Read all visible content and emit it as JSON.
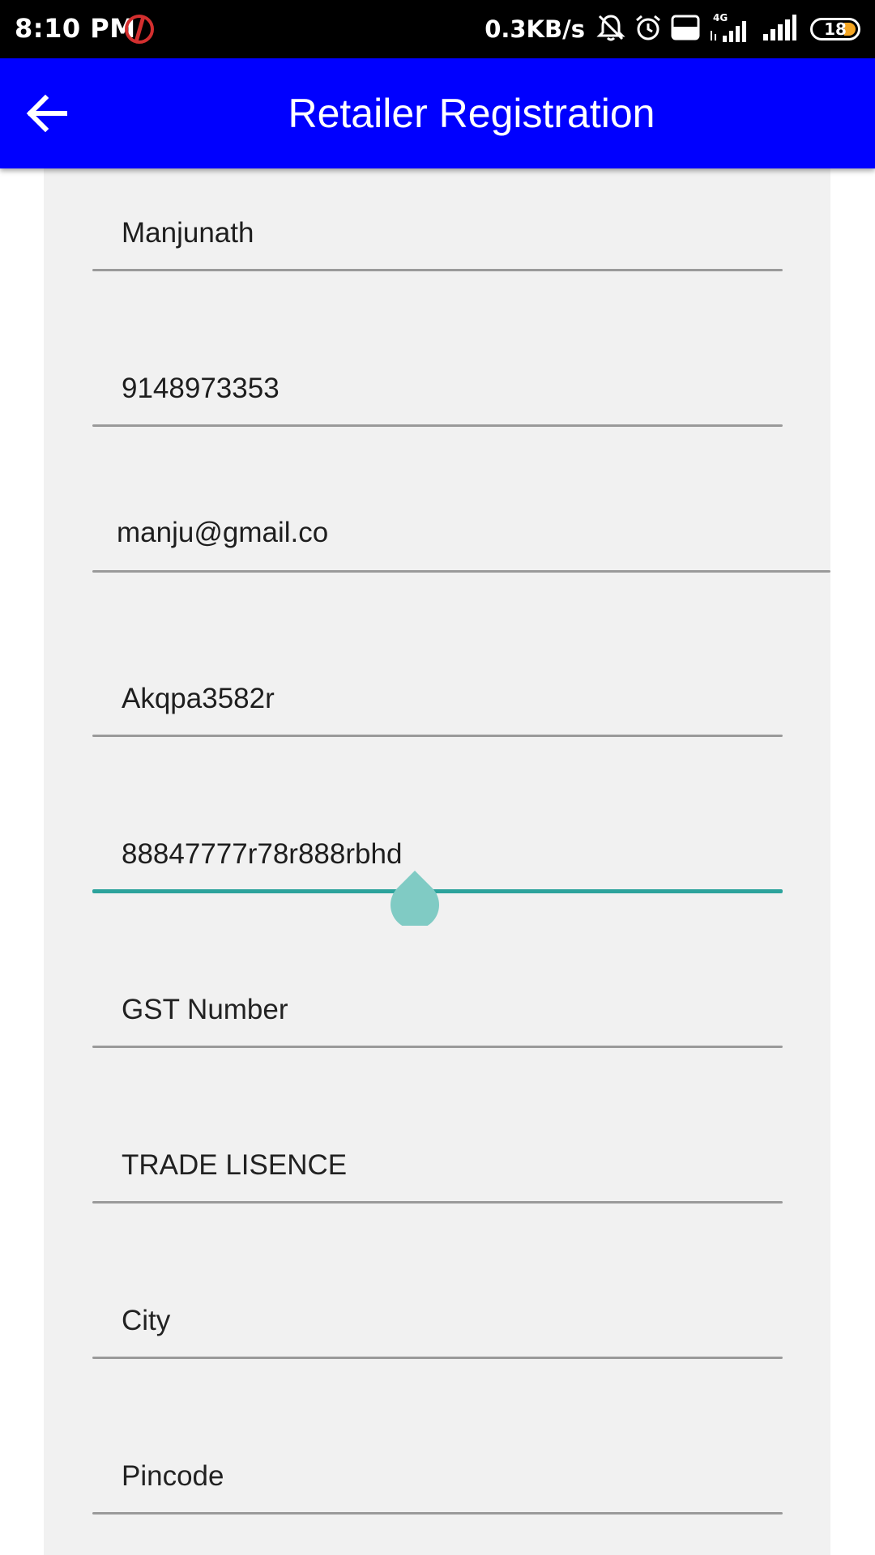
{
  "status_bar": {
    "time": "8:10 PM",
    "net_speed": "0.3KB/s",
    "network_type": "4G",
    "volte_label": "Vo LTE",
    "battery_level": "18",
    "icons": [
      "app-notification-icon",
      "bell-off-icon",
      "alarm-icon",
      "volte-icon",
      "signal-4g-icon",
      "signal-icon",
      "battery-icon"
    ]
  },
  "app_bar": {
    "title": "Retailer Registration",
    "back_icon": "arrow-back-icon",
    "background": "#0000ff"
  },
  "form": {
    "fields": [
      {
        "name": "name",
        "value": "Manjunath",
        "is_placeholder": false
      },
      {
        "name": "mobile",
        "value": "9148973353",
        "is_placeholder": false
      },
      {
        "name": "email",
        "value": "manju@gmail.co",
        "is_placeholder": false
      },
      {
        "name": "pan",
        "value": "Akqpa3582r",
        "is_placeholder": false
      },
      {
        "name": "aadhaar",
        "value": "88847777r78r888rbhd",
        "is_placeholder": false,
        "focused": true
      },
      {
        "name": "gst",
        "value": "GST Number",
        "is_placeholder": true
      },
      {
        "name": "trade-license",
        "value": "TRADE LISENCE",
        "is_placeholder": true
      },
      {
        "name": "city",
        "value": "City",
        "is_placeholder": true
      },
      {
        "name": "pincode",
        "value": "Pincode",
        "is_placeholder": true
      }
    ],
    "focus_color": "#2ca39c",
    "handle_color": "#80cbc4",
    "card_background": "#f1f1f1"
  }
}
